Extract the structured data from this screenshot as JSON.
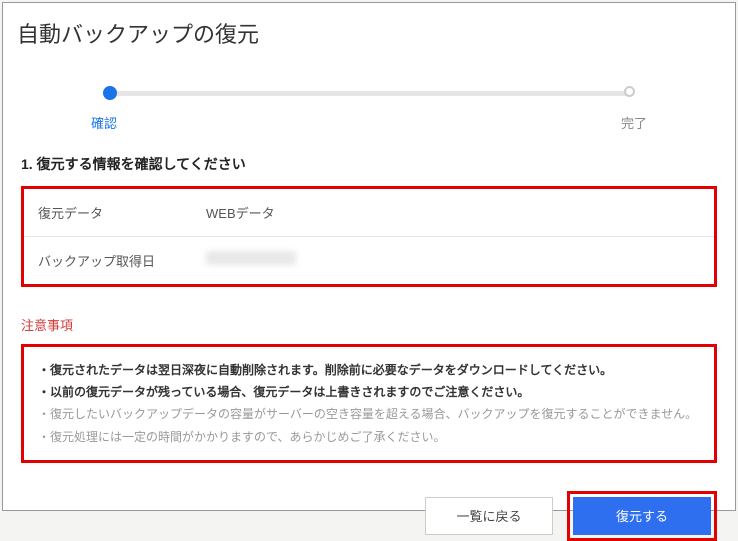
{
  "title": "自動バックアップの復元",
  "progress": {
    "step1": "確認",
    "step2": "完了"
  },
  "section_heading": "1. 復元する情報を確認してください",
  "info": {
    "label_data": "復元データ",
    "value_data": "WEBデータ",
    "label_date": "バックアップ取得日"
  },
  "notice_heading": "注意事項",
  "notices": {
    "n1": "・復元されたデータは翌日深夜に自動削除されます。削除前に必要なデータをダウンロードしてください。",
    "n2": "・以前の復元データが残っている場合、復元データは上書きされますのでご注意ください。",
    "n3": "・復元したいバックアップデータの容量がサーバーの空き容量を超える場合、バックアップを復元することができません。",
    "n4": "・復元処理には一定の時間がかかりますので、あらかじめご了承ください。"
  },
  "buttons": {
    "back": "一覧に戻る",
    "restore": "復元する"
  }
}
